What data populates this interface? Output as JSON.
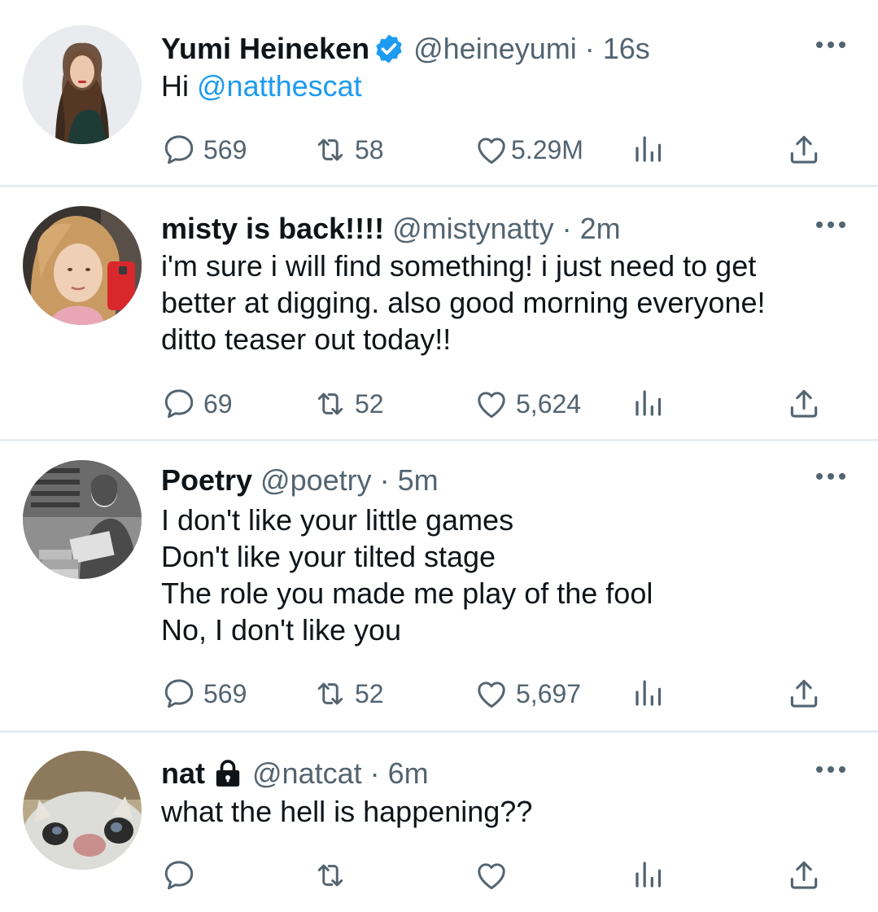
{
  "colors": {
    "text": "#0f1419",
    "secondary": "#536471",
    "accent": "#1d9bf0",
    "divider": "#e6ecf0"
  },
  "icons": {
    "reply": "speech-bubble",
    "retweet": "retweet-arrows",
    "like": "heart",
    "views": "bar-chart",
    "share": "upload-arrow",
    "more": "three-dots",
    "verified": "verified-badge",
    "protected": "lock"
  },
  "tweets": [
    {
      "name": "Yumi Heineken",
      "verified": true,
      "handle_time": "@heineyumi · 16s",
      "text_plain": "Hi ",
      "mention": "@natthescat",
      "reply_count": "569",
      "retweet_count": "58",
      "like_count": "5.29M"
    },
    {
      "name": "misty is back!!!!",
      "handle_time": "@mistynatty · 2m",
      "text": "i'm sure i will find something! i just need to get\nbetter at digging. also good morning everyone!\nditto teaser out today!!",
      "reply_count": "69",
      "retweet_count": "52",
      "like_count": "5,624"
    },
    {
      "name": "Poetry",
      "handle_time": "@poetry · 5m",
      "text": "I don't like your little games\nDon't like your tilted stage\nThe role you made me play of the fool\nNo, I don't like you",
      "reply_count": "569",
      "retweet_count": "52",
      "like_count": "5,697"
    },
    {
      "name": "nat",
      "protected": true,
      "handle_time": "@natcat · 6m",
      "text": "what the hell is happening??",
      "reply_count": "",
      "retweet_count": "",
      "like_count": ""
    }
  ]
}
